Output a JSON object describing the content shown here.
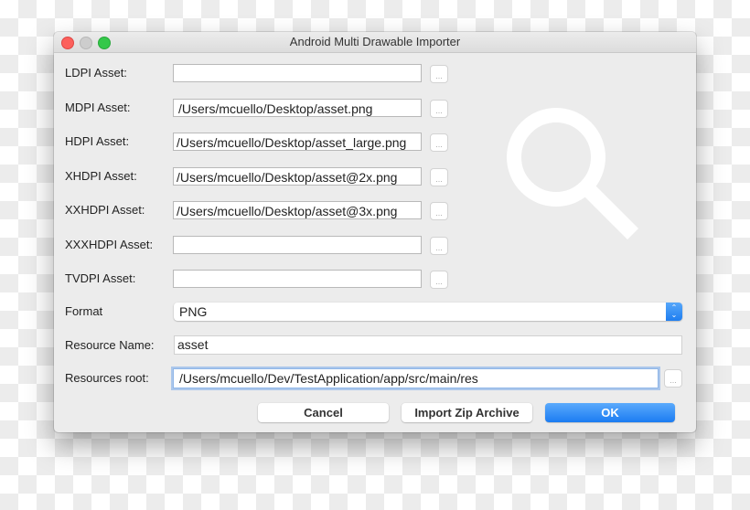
{
  "window": {
    "title": "Android Multi Drawable Importer",
    "controls": {
      "close": "close",
      "minimize": "minimize",
      "maximize": "maximize"
    }
  },
  "assets": [
    {
      "label": "LDPI Asset:",
      "value": "",
      "browse": "..."
    },
    {
      "label": "MDPI Asset:",
      "value": "/Users/mcuello/Desktop/asset.png",
      "browse": "..."
    },
    {
      "label": "HDPI Asset:",
      "value": "/Users/mcuello/Desktop/asset_large.png",
      "browse": "..."
    },
    {
      "label": "XHDPI Asset:",
      "value": "/Users/mcuello/Desktop/asset@2x.png",
      "browse": "..."
    },
    {
      "label": "XXHDPI Asset:",
      "value": "/Users/mcuello/Desktop/asset@3x.png",
      "browse": "..."
    },
    {
      "label": "XXXHDPI Asset:",
      "value": "",
      "browse": "..."
    },
    {
      "label": "TVDPI Asset:",
      "value": "",
      "browse": "..."
    }
  ],
  "format": {
    "label": "Format",
    "selected": "PNG",
    "arrows_icon": "up-down-chevron-icon"
  },
  "resource_name": {
    "label": "Resource Name:",
    "value": "asset"
  },
  "resources_root": {
    "label": "Resources root:",
    "value": "/Users/mcuello/Dev/TestApplication/app/src/main/res",
    "browse": "..."
  },
  "buttons": {
    "cancel": "Cancel",
    "import_zip": "Import Zip Archive",
    "ok": "OK"
  },
  "preview": {
    "icon": "magnifier-icon"
  },
  "colors": {
    "accent": "#1b7cf2",
    "close": "#fc605c",
    "minimize": "#cdcdcd",
    "maximize": "#34c84a"
  }
}
